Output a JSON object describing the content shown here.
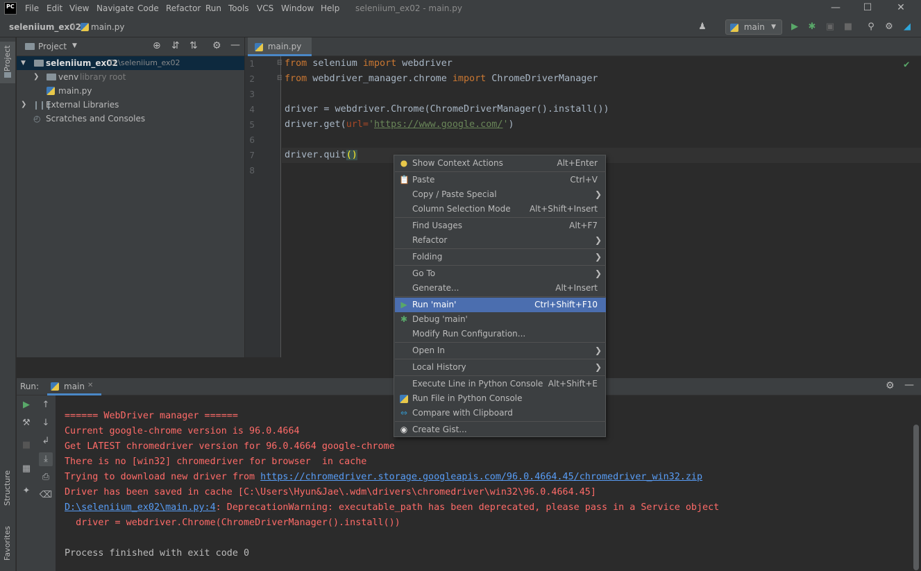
{
  "titlebar": {
    "logo": "PC",
    "menus": [
      "File",
      "Edit",
      "View",
      "Navigate",
      "Code",
      "Refactor",
      "Run",
      "Tools",
      "VCS",
      "Window",
      "Help"
    ],
    "window_title": "seleniium_ex02 - main.py"
  },
  "navbar": {
    "project": "seleniium_ex02",
    "file": "main.py",
    "run_config": "main"
  },
  "left_stripe": {
    "project_tab": "Project",
    "structure_tab": "Structure",
    "favorites_tab": "Favorites"
  },
  "project_panel": {
    "header": "Project",
    "tree": [
      {
        "name": "seleniium_ex02",
        "extra": "D:\\seleniium_ex02"
      },
      {
        "name": "venv",
        "extra": "library root"
      },
      {
        "name": "main.py",
        "extra": ""
      },
      {
        "name": "External Libraries",
        "extra": ""
      },
      {
        "name": "Scratches and Consoles",
        "extra": ""
      }
    ]
  },
  "editor": {
    "tab": "main.py",
    "line_numbers": [
      "1",
      "2",
      "3",
      "4",
      "5",
      "6",
      "7",
      "8"
    ],
    "lines": {
      "l1": {
        "kw1": "from",
        "t1": " selenium ",
        "kw2": "import",
        "t2": " webdriver"
      },
      "l2": {
        "kw1": "from",
        "t1": " webdriver_manager.chrome ",
        "kw2": "import",
        "t2": " ChromeDriverManager"
      },
      "l4": {
        "t1": "driver = webdriver.Chrome(ChromeDriverManager().install())"
      },
      "l5": {
        "t1": "driver.get(",
        "param": "url=",
        "q1": "'",
        "url": "https://www.google.com/",
        "q2": "'",
        "t2": ")"
      },
      "l7": {
        "t1": "driver.quit",
        "paren": "()"
      }
    }
  },
  "run_panel": {
    "label": "Run:",
    "tab": "main",
    "output": {
      "o1": "====== WebDriver manager ======",
      "o2": "Current google-chrome version is 96.0.4664",
      "o3": "Get LATEST chromedriver version for 96.0.4664 google-chrome",
      "o4": "There is no [win32] chromedriver for browser  in cache",
      "o5_text": "Trying to download new driver from ",
      "o5_link": "https://chromedriver.storage.googleapis.com/96.0.4664.45/chromedriver_win32.zip",
      "o6": "Driver has been saved in cache [C:\\Users\\Hyun&Jae\\.wdm\\drivers\\chromedriver\\win32\\96.0.4664.45]",
      "o7_link": "D:\\seleniium_ex02\\main.py:4",
      "o7_text": ": DeprecationWarning: executable_path has been deprecated, please pass in a Service object",
      "o8": "  driver = webdriver.Chrome(ChromeDriverManager().install())",
      "o10": "Process finished with exit code 0"
    }
  },
  "context_menu": {
    "items": [
      {
        "label": "Show Context Actions",
        "shortcut": "Alt+Enter"
      },
      {
        "label": "Paste",
        "shortcut": "Ctrl+V"
      },
      {
        "label": "Copy / Paste Special",
        "shortcut": ""
      },
      {
        "label": "Column Selection Mode",
        "shortcut": "Alt+Shift+Insert"
      },
      {
        "label": "Find Usages",
        "shortcut": "Alt+F7"
      },
      {
        "label": "Refactor",
        "shortcut": ""
      },
      {
        "label": "Folding",
        "shortcut": ""
      },
      {
        "label": "Go To",
        "shortcut": ""
      },
      {
        "label": "Generate...",
        "shortcut": "Alt+Insert"
      },
      {
        "label": "Run 'main'",
        "shortcut": "Ctrl+Shift+F10"
      },
      {
        "label": "Debug 'main'",
        "shortcut": ""
      },
      {
        "label": "Modify Run Configuration...",
        "shortcut": ""
      },
      {
        "label": "Open In",
        "shortcut": ""
      },
      {
        "label": "Local History",
        "shortcut": ""
      },
      {
        "label": "Execute Line in Python Console",
        "shortcut": "Alt+Shift+E"
      },
      {
        "label": "Run File in Python Console",
        "shortcut": ""
      },
      {
        "label": "Compare with Clipboard",
        "shortcut": ""
      },
      {
        "label": "Create Gist...",
        "shortcut": ""
      }
    ]
  },
  "colors": {
    "accent": "#4b6eaf",
    "error_output": "#ff6b68",
    "link": "#589df6",
    "keyword": "#cc7832",
    "run_green": "#59a869"
  }
}
